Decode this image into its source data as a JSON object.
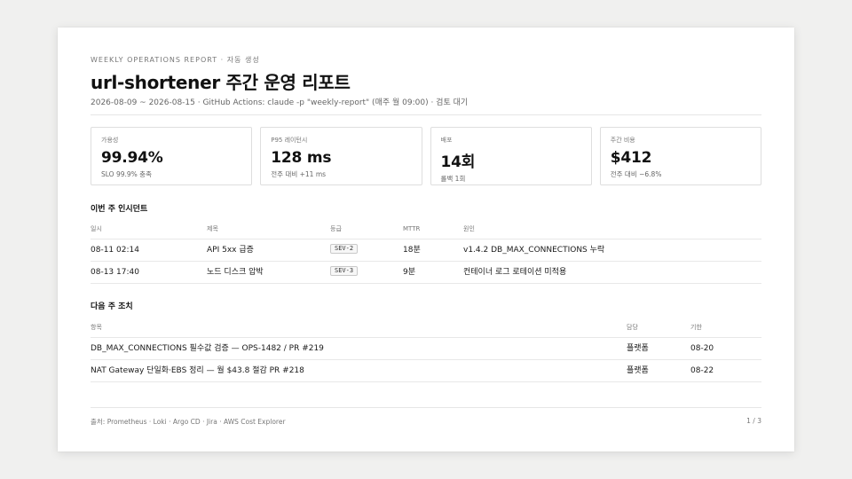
{
  "report": {
    "eyebrow": "WEEKLY OPERATIONS REPORT · 자동 생성",
    "title": "url-shortener 주간 운영 리포트",
    "meta": "2026-08-09 ~ 2026-08-15 · GitHub Actions: claude -p \"weekly-report\" (매주 월 09:00) · 검토 대기"
  },
  "kpis": [
    {
      "label": "가용성",
      "value": "99.94%",
      "note": "SLO 99.9% 충족"
    },
    {
      "label": "P95 레이턴시",
      "value": "128 ms",
      "note": "전주 대비 +11 ms"
    },
    {
      "label": "배포",
      "value": "14회",
      "note": "롤백 1회"
    },
    {
      "label": "주간 비용",
      "value": "$412",
      "note": "전주 대비 −6.8%"
    }
  ],
  "incidents": {
    "title": "이번 주 인시던트",
    "columns": [
      "일시",
      "제목",
      "등급",
      "MTTR",
      "원인"
    ],
    "rows": [
      {
        "time": "08-11 02:14",
        "subject": "API 5xx 급증",
        "severity": "SEV-2",
        "mttr": "18분",
        "cause": "v1.4.2 DB_MAX_CONNECTIONS 누락"
      },
      {
        "time": "08-13 17:40",
        "subject": "노드 디스크 압박",
        "severity": "SEV-3",
        "mttr": "9분",
        "cause": "컨테이너 로그 로테이션 미적용"
      }
    ]
  },
  "actions": {
    "title": "다음 주 조치",
    "columns": [
      "항목",
      "담당",
      "기한"
    ],
    "rows": [
      {
        "item": "DB_MAX_CONNECTIONS 필수값 검증 — OPS-1482 / PR #219",
        "owner": "플랫폼",
        "due": "08-20"
      },
      {
        "item": "NAT Gateway 단일화·EBS 정리 — 월 $43.8 절감 PR #218",
        "owner": "플랫폼",
        "due": "08-22"
      }
    ]
  },
  "footer": {
    "sources": "출처: Prometheus · Loki · Argo CD · Jira · AWS Cost Explorer",
    "page": "1 / 3"
  }
}
